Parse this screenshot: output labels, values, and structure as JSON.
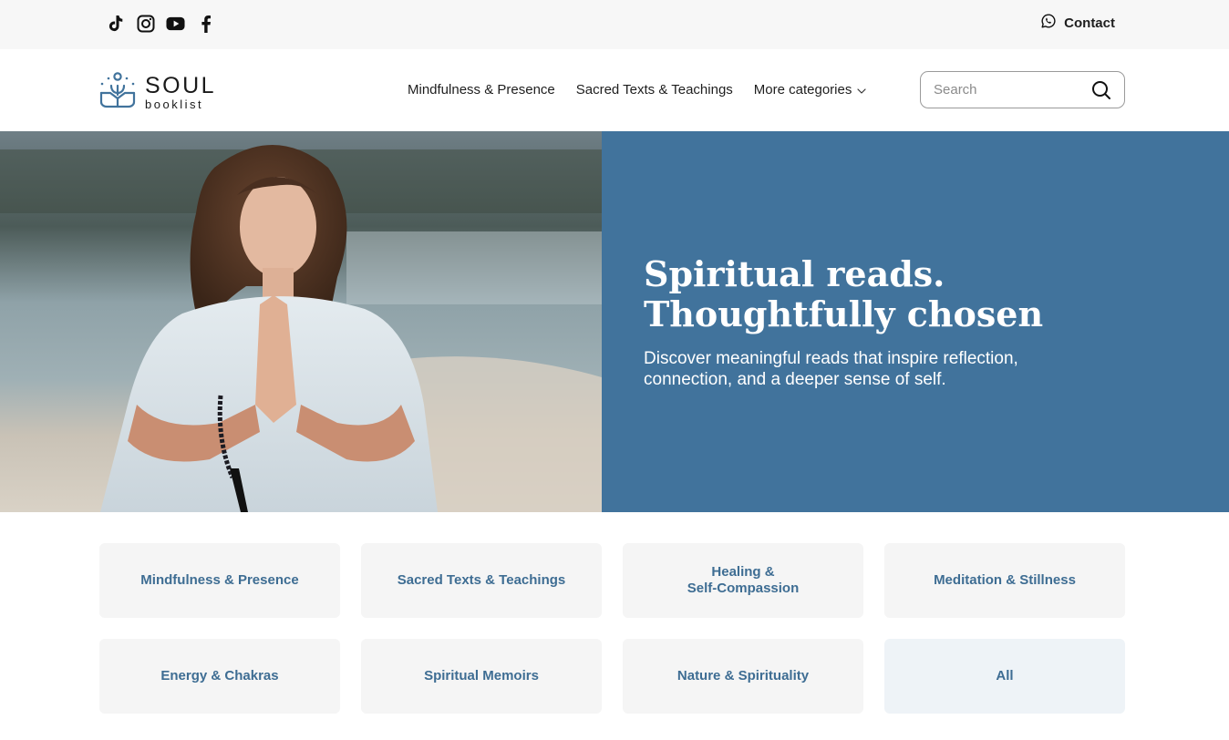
{
  "topbar": {
    "social": [
      {
        "icon": "tiktok-icon"
      },
      {
        "icon": "instagram-icon"
      },
      {
        "icon": "youtube-icon"
      },
      {
        "icon": "facebook-icon"
      }
    ],
    "contact_label": "Contact",
    "contact_icon": "whatsapp-icon"
  },
  "header": {
    "logo_main": "SOUL",
    "logo_sub": "booklist",
    "nav": [
      {
        "label": "Mindfulness & Presence"
      },
      {
        "label": "Sacred Texts & Teachings"
      },
      {
        "label": "More categories",
        "icon": "chevron-down-icon"
      }
    ],
    "search_placeholder": "Search"
  },
  "hero": {
    "title_line1": "Spiritual reads.",
    "title_line2": "Thoughtfully chosen",
    "subtitle": "Discover meaningful reads that inspire reflection, connection, and a deeper sense of self.",
    "panel_color": "#41739c"
  },
  "categories": [
    {
      "label": "Mindfulness & Presence"
    },
    {
      "label": "Sacred Texts & Teachings"
    },
    {
      "label": "Healing &\nSelf-Compassion"
    },
    {
      "label": "Meditation & Stillness"
    },
    {
      "label": "Energy & Chakras"
    },
    {
      "label": "Spiritual Memoirs"
    },
    {
      "label": "Nature & Spirituality"
    },
    {
      "label": "All"
    }
  ],
  "colors": {
    "accent": "#41739c",
    "card_text": "#3e6d93",
    "card_bg": "#f5f5f5",
    "topbar_bg": "#f7f7f7"
  }
}
